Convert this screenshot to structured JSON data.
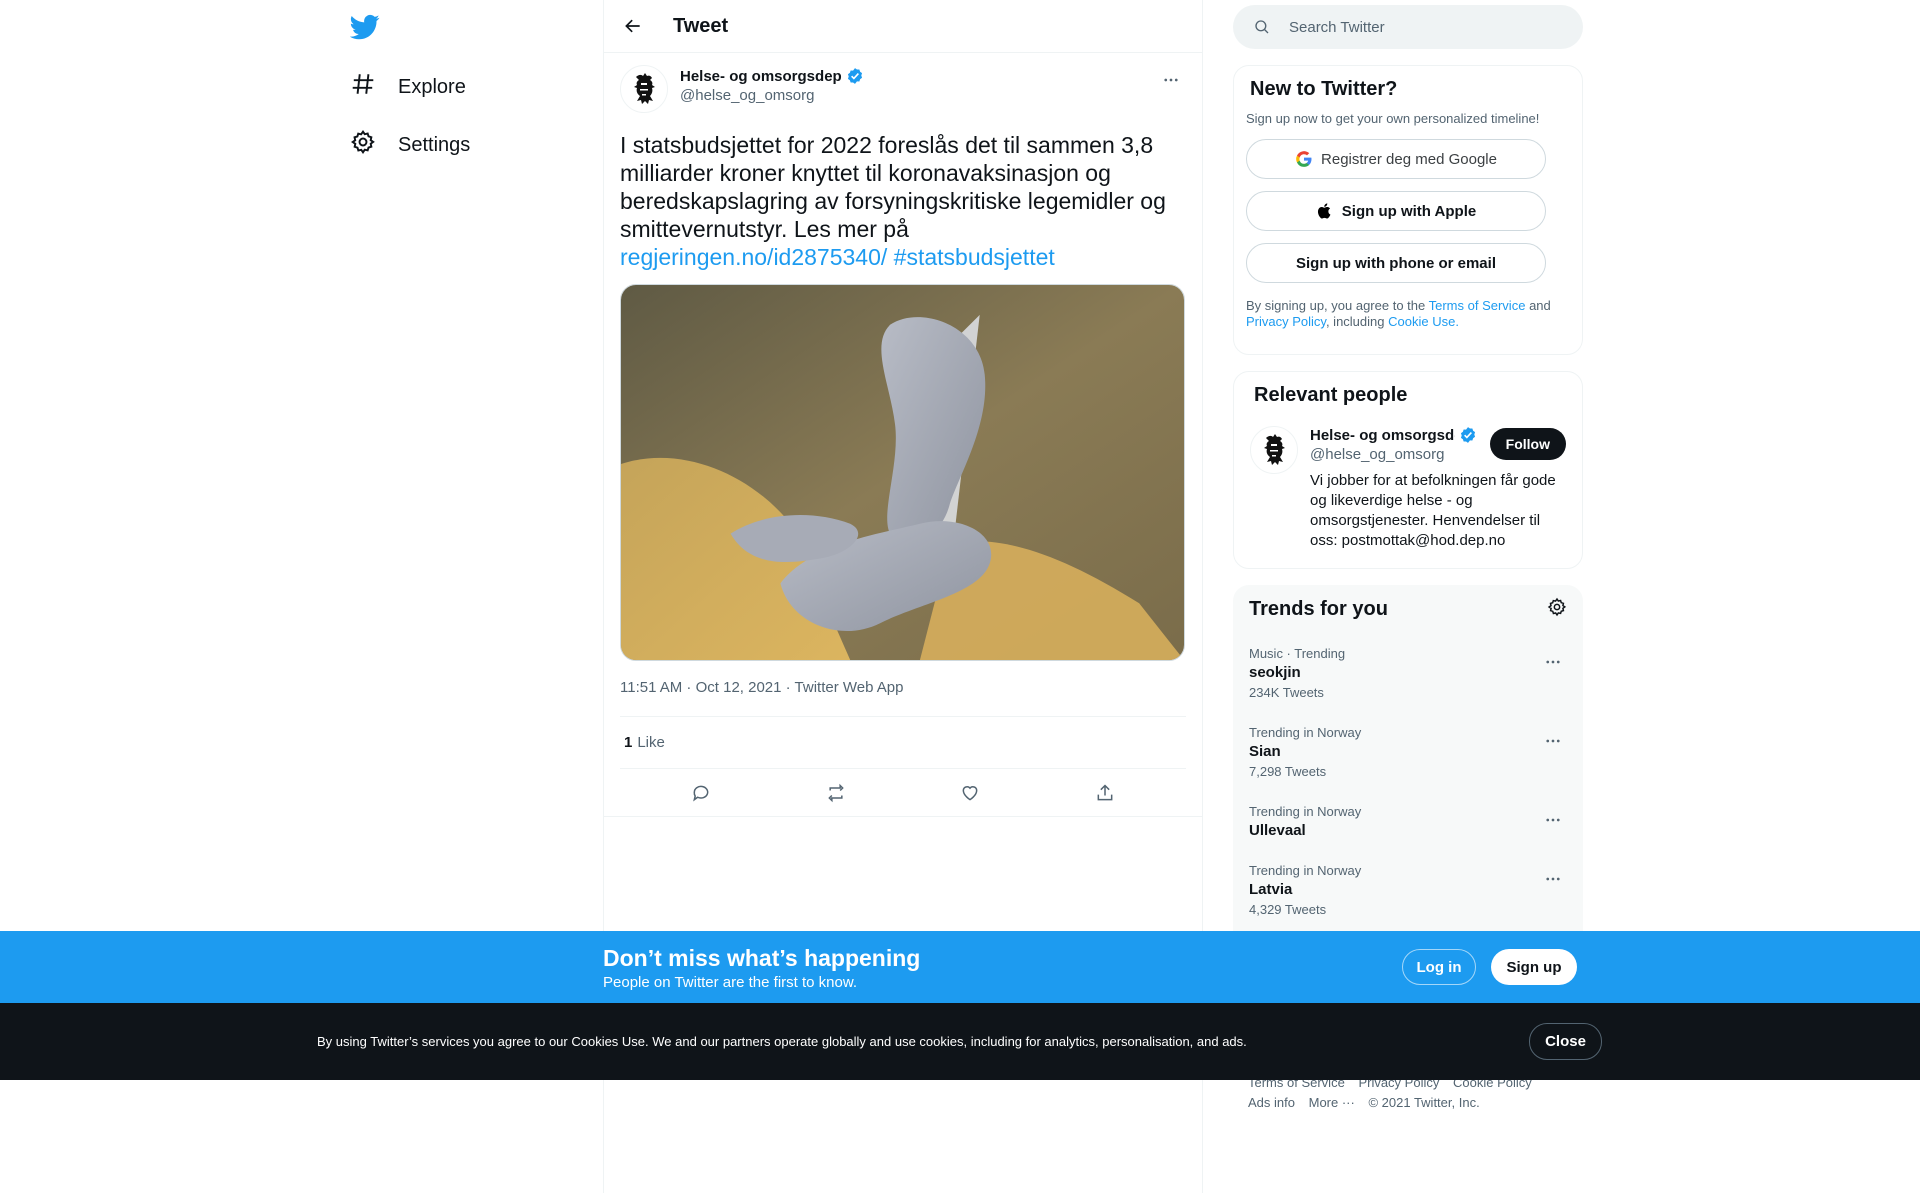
{
  "nav": {
    "items": [
      {
        "label": "Explore",
        "icon": "hashtag-icon"
      },
      {
        "label": "Settings",
        "icon": "gear-icon"
      }
    ]
  },
  "header": {
    "title": "Tweet"
  },
  "tweet": {
    "author_name": "Helse- og omsorgsdep",
    "author_handle": "@helse_og_omsorg",
    "text": "I statsbudsjettet for 2022 foreslås det til sammen 3,8 milliarder kroner knyttet til koronavaksinasjon og beredskapslagring av forsyningskritiske legemidler og smittevernutstyr. Les mer på",
    "link": "regjeringen.no/id2875340/",
    "hashtag": "#statsbudsjettet",
    "meta": "11:51 AM · Oct 12, 2021 · Twitter Web App",
    "likes_count": "1",
    "likes_label": "Like"
  },
  "search": {
    "placeholder": "Search Twitter"
  },
  "signup": {
    "title": "New to Twitter?",
    "subtitle": "Sign up now to get your own personalized timeline!",
    "google_label": "Registrer deg med Google",
    "apple_label": "Sign up with Apple",
    "phone_label": "Sign up with phone or email",
    "terms_prefix": "By signing up, you agree to the",
    "terms_link": "Terms of Service",
    "terms_and": "and",
    "privacy_link": "Privacy Policy",
    "terms_including": ", including",
    "cookie_link": "Cookie Use."
  },
  "people": {
    "title": "Relevant people",
    "name": "Helse- og omsorgsdep",
    "handle": "@helse_og_omsorg",
    "bio": "Vi jobber for at befolkningen får gode og likeverdige helse - og omsorgstjenester. Henvendelser til oss: postmottak@hod.dep.no",
    "follow_label": "Follow"
  },
  "trends": {
    "title": "Trends for you",
    "items": [
      {
        "context": "Music · Trending",
        "name": "seokjin",
        "count": "234K Tweets"
      },
      {
        "context": "Trending in Norway",
        "name": "Sian",
        "count": "7,298 Tweets"
      },
      {
        "context": "Trending in Norway",
        "name": "Ullevaal",
        "count": ""
      },
      {
        "context": "Trending in Norway",
        "name": "Latvia",
        "count": "4,329 Tweets"
      }
    ]
  },
  "footer": {
    "terms": "Terms of Service",
    "privacy": "Privacy Policy",
    "cookie": "Cookie Policy",
    "ads": "Ads info",
    "more": "More ···",
    "copyright": "© 2021 Twitter, Inc."
  },
  "promo": {
    "title": "Don’t miss what’s happening",
    "subtitle": "People on Twitter are the first to know.",
    "login_label": "Log in",
    "signup_label": "Sign up"
  },
  "cookie_banner": {
    "text": "By using Twitter’s services you agree to our Cookies Use. We and our partners operate globally and use cookies, including for analytics, personalisation, and ads.",
    "close_label": "Close"
  },
  "colors": {
    "accent": "#1d9bf0",
    "text": "#0f1419",
    "secondary": "#536471",
    "banner_dark": "#0f1419"
  }
}
